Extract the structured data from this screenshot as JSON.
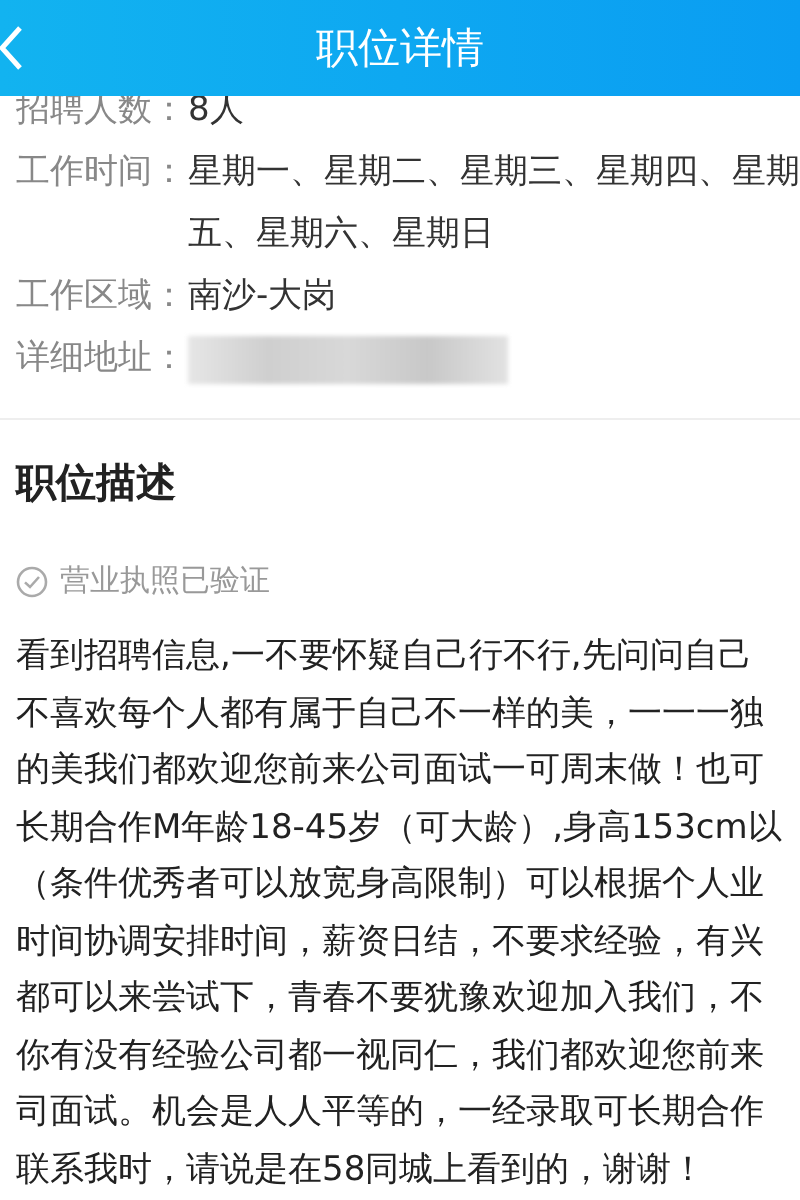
{
  "header": {
    "title": "职位详情"
  },
  "info": [
    {
      "label": "招聘人数：",
      "lines": [
        "8人"
      ]
    },
    {
      "label": "工作时间：",
      "lines": [
        "星期一、星期二、星期三、星期四、星期",
        "五、星期六、星期日"
      ]
    },
    {
      "label": "工作区域：",
      "lines": [
        "南沙-大岗"
      ]
    },
    {
      "label": "详细地址：",
      "redacted": true
    }
  ],
  "description": {
    "heading": "职位描述",
    "verified": "营业执照已验证",
    "lines": [
      "看到招聘信息,一不要怀疑自己行不行,先问问自己",
      "不喜欢每个人都有属于自己不一样的美，一一一独",
      "的美我们都欢迎您前来公司面试一可周末做！也可",
      "长期合作M年龄18-45岁（可大龄）,身高153cm以",
      "（条件优秀者可以放宽身高限制）可以根据个人业",
      "时间协调安排时间，薪资日结，不要求经验，有兴",
      "都可以来尝试下，青春不要犹豫欢迎加入我们，不",
      "你有没有经验公司都一视同仁，我们都欢迎您前来",
      "司面试。机会是人人平等的，一经录取可长期合作",
      "联系我时，请说是在58同城上看到的，谢谢！"
    ]
  }
}
